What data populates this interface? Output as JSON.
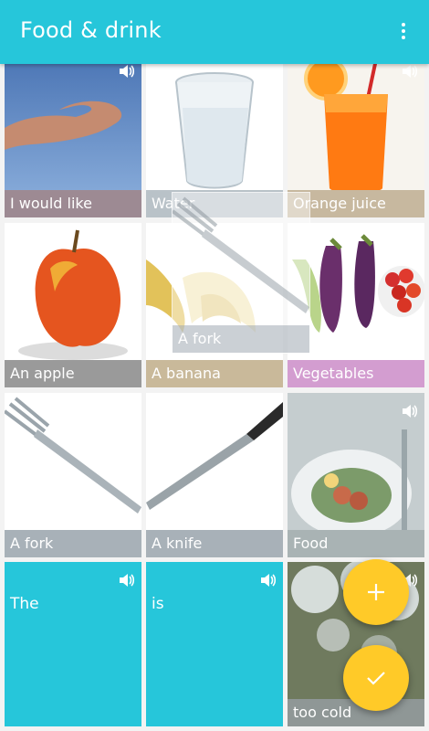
{
  "app": {
    "title": "Food & drink",
    "menu_icon": "more-vert-icon"
  },
  "tiles": [
    {
      "label": "I would like",
      "image": "hand-icon",
      "caption_color": "#9d8a93"
    },
    {
      "label": "Water",
      "image": "glass-icon",
      "caption_color": "#b9c2c8"
    },
    {
      "label": "Orange juice",
      "image": "juice-icon",
      "caption_color": "#c7b89f"
    },
    {
      "label": "An apple",
      "image": "apple-icon",
      "caption_color": "#9a9a9a"
    },
    {
      "label": "A banana",
      "image": "banana-icon",
      "caption_color": "#c9b99a"
    },
    {
      "label": "Vegetables",
      "image": "eggplant-icon",
      "caption_color": "#d39dd0"
    },
    {
      "label": "A fork",
      "image": "fork-icon",
      "caption_color": "#a8b1b8"
    },
    {
      "label": "A knife",
      "image": "knife-icon",
      "caption_color": "#a8b1b8"
    },
    {
      "label": "Food",
      "image": "plate-icon",
      "caption_color": "#a9b3b4"
    },
    {
      "label": "The",
      "image": "",
      "caption_color": "#26c6da"
    },
    {
      "label": "is",
      "image": "",
      "caption_color": "#26c6da"
    },
    {
      "label": "too cold",
      "image": "frost-icon",
      "caption_color": "#8f9796"
    }
  ],
  "drag_preview": {
    "label": "A fork"
  },
  "fab_add": {
    "icon": "plus-icon"
  },
  "fab_done": {
    "icon": "check-icon"
  },
  "colors": {
    "primary": "#26c6da",
    "accent": "#ffca28"
  }
}
